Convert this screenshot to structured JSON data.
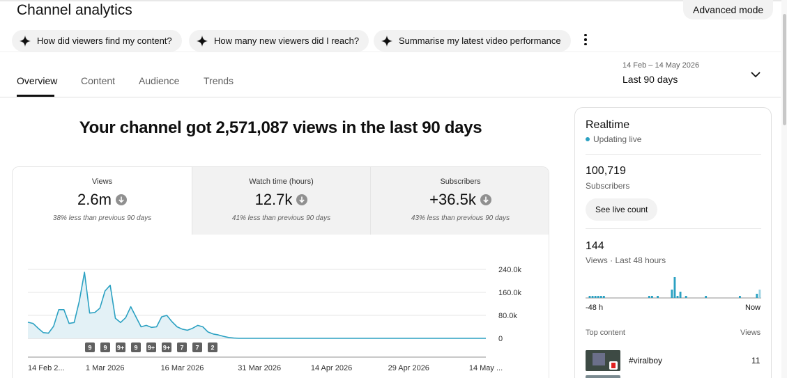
{
  "header": {
    "title": "Channel analytics",
    "advanced_mode": "Advanced mode"
  },
  "chips": [
    {
      "label": "How did viewers find my content?"
    },
    {
      "label": "How many new viewers did I reach?"
    },
    {
      "label": "Summarise my latest video performance"
    }
  ],
  "tabs": [
    {
      "label": "Overview",
      "active": true
    },
    {
      "label": "Content",
      "active": false
    },
    {
      "label": "Audience",
      "active": false
    },
    {
      "label": "Trends",
      "active": false
    }
  ],
  "date_picker": {
    "range": "14 Feb – 14 May 2026",
    "label": "Last 90 days"
  },
  "headline": "Your channel got 2,571,087 views in the last 90 days",
  "metrics": [
    {
      "label": "Views",
      "value": "2.6m",
      "compare": "38% less than previous 90 days"
    },
    {
      "label": "Watch time (hours)",
      "value": "12.7k",
      "compare": "41% less than previous 90 days"
    },
    {
      "label": "Subscribers",
      "value": "+36.5k",
      "compare": "43% less than previous 90 days"
    }
  ],
  "chart_data": {
    "type": "area",
    "ylim": [
      0,
      240000
    ],
    "y_ticks": [
      "240.0k",
      "160.0k",
      "80.0k",
      "0"
    ],
    "y_tick_values": [
      240000,
      160000,
      80000,
      0
    ],
    "x_ticks": [
      "14 Feb 2...",
      "1 Mar 2026",
      "16 Mar 2026",
      "31 Mar 2026",
      "14 Apr 2026",
      "29 Apr 2026",
      "14 May ..."
    ],
    "x_tick_days": [
      0,
      15,
      30,
      45,
      59,
      74,
      89
    ],
    "days": 90,
    "values": [
      56000,
      52000,
      35000,
      20000,
      18000,
      42000,
      100000,
      100000,
      52000,
      55000,
      130000,
      230000,
      88000,
      90000,
      105000,
      165000,
      185000,
      70000,
      55000,
      72000,
      110000,
      75000,
      40000,
      45000,
      38000,
      40000,
      75000,
      80000,
      58000,
      40000,
      32000,
      28000,
      35000,
      45000,
      40000,
      22000,
      15000,
      12000,
      7000,
      3000,
      1000,
      0,
      0,
      0,
      0,
      0,
      0,
      0,
      0,
      0,
      0,
      0,
      0,
      0,
      0,
      0,
      0,
      0,
      0,
      0,
      0,
      0,
      0,
      0,
      0,
      0,
      0,
      0,
      0,
      0,
      0,
      0,
      0,
      0,
      0,
      0,
      0,
      0,
      0,
      0,
      0,
      0,
      0,
      0,
      0,
      0,
      0,
      0,
      0,
      0
    ],
    "annotations": [
      {
        "day": 12,
        "label": "9"
      },
      {
        "day": 15,
        "label": "9"
      },
      {
        "day": 18,
        "label": "9+"
      },
      {
        "day": 21,
        "label": "9"
      },
      {
        "day": 24,
        "label": "9+"
      },
      {
        "day": 27,
        "label": "9+"
      },
      {
        "day": 30,
        "label": "7"
      },
      {
        "day": 33,
        "label": "7"
      },
      {
        "day": 36,
        "label": "2"
      }
    ],
    "color": "#2ba1c2"
  },
  "realtime": {
    "title": "Realtime",
    "status": "Updating live",
    "subscribers": "100,719",
    "subscribers_label": "Subscribers",
    "live_button": "See live count",
    "views": "144",
    "views_label": "Views · Last 48 hours",
    "axis_left": "-48 h",
    "axis_right": "Now",
    "bars": [
      0,
      1,
      1,
      1,
      1,
      1,
      1,
      0,
      0,
      0,
      0,
      0,
      0,
      0,
      0,
      0,
      0,
      0,
      0,
      0,
      0,
      0,
      1,
      1,
      0,
      1,
      0,
      0,
      0,
      0,
      4,
      10,
      1,
      3,
      0,
      1,
      0,
      0,
      0,
      0,
      0,
      0,
      1,
      0,
      0,
      0,
      0,
      0,
      0,
      0,
      0,
      0,
      0,
      0,
      1,
      0,
      0,
      0,
      0,
      0,
      2,
      4
    ],
    "top_content_label": "Top content",
    "top_views_label": "Views",
    "top_items": [
      {
        "title": "#viralboy",
        "views": "11"
      }
    ]
  }
}
